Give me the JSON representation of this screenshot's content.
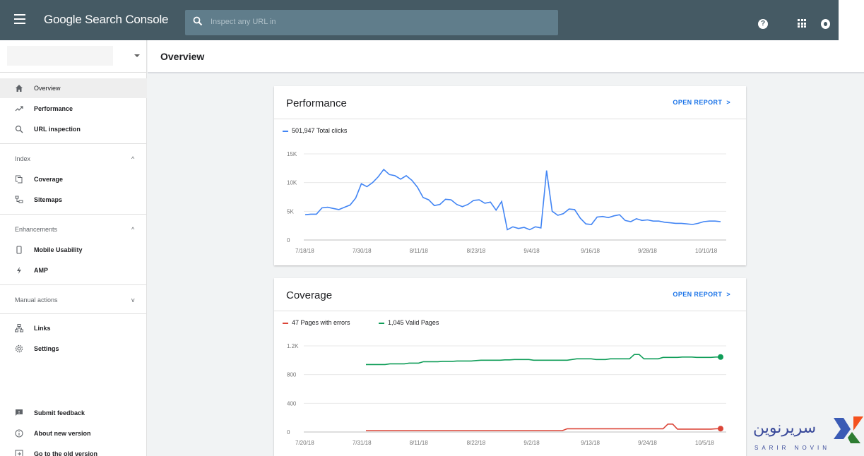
{
  "app": {
    "title": "Google Search Console",
    "search_placeholder": "Inspect any URL in",
    "icons": [
      "menu-icon",
      "search-icon",
      "help-icon",
      "apps-icon",
      "notifications-icon"
    ]
  },
  "sidebar": {
    "items_top": [
      {
        "label": "Overview",
        "icon": "home-icon"
      },
      {
        "label": "Performance",
        "icon": "trending-icon"
      },
      {
        "label": "URL inspection",
        "icon": "search-icon"
      }
    ],
    "index": {
      "label": "Index",
      "items": [
        {
          "label": "Coverage",
          "icon": "coverage-icon"
        },
        {
          "label": "Sitemaps",
          "icon": "sitemap-icon"
        }
      ]
    },
    "enhancements": {
      "label": "Enhancements",
      "items": [
        {
          "label": "Mobile Usability",
          "icon": "phone-icon"
        },
        {
          "label": "AMP",
          "icon": "bolt-icon"
        }
      ]
    },
    "manual_actions": {
      "label": "Manual actions"
    },
    "items_mid": [
      {
        "label": "Links",
        "icon": "links-icon"
      },
      {
        "label": "Settings",
        "icon": "gear-icon"
      }
    ],
    "items_bottom": [
      {
        "label": "Submit feedback",
        "icon": "feedback-icon"
      },
      {
        "label": "About new version",
        "icon": "info-icon"
      },
      {
        "label": "Go to the old version",
        "icon": "exit-icon"
      }
    ]
  },
  "main": {
    "title": "Overview"
  },
  "performance": {
    "title": "Performance",
    "open_report": "OPEN REPORT",
    "legend": "501,947 Total clicks",
    "color": "#4285f4"
  },
  "coverage": {
    "title": "Coverage",
    "open_report": "OPEN REPORT",
    "legend_errors": "47 Pages with errors",
    "legend_valid": "1,045 Valid Pages",
    "color_errors": "#db4437",
    "color_valid": "#0f9d58"
  },
  "watermark": {
    "text_fa": "سریرنوین",
    "text_en": "SARIR NOVIN"
  },
  "chart_data": [
    {
      "type": "line",
      "x": [
        "7/18/18",
        "7/30/18",
        "8/11/18",
        "8/23/18",
        "9/4/18",
        "9/16/18",
        "9/28/18",
        "10/10/18"
      ],
      "ytick_labels": [
        "0",
        "5K",
        "10K",
        "15K"
      ],
      "ylim": [
        0,
        15000
      ],
      "grid": true,
      "series": [
        {
          "name": "501,947 Total clicks",
          "values": [
            4400,
            4500,
            4500,
            5600,
            5700,
            5500,
            5300,
            5700,
            6100,
            7300,
            9800,
            9300,
            10000,
            11000,
            12300,
            11400,
            11200,
            10600,
            11200,
            10400,
            9200,
            7400,
            7000,
            6000,
            6200,
            7100,
            7000,
            6200,
            5800,
            6200,
            6900,
            7000,
            6400,
            6600,
            5200,
            6700,
            1800,
            2300,
            2000,
            2200,
            1800,
            2300,
            2100,
            12100,
            5000,
            4300,
            4600,
            5400,
            5300,
            3800,
            2800,
            2700,
            4000,
            4100,
            3900,
            4200,
            4400,
            3400,
            3200,
            3700,
            3400,
            3500,
            3300,
            3300,
            3100,
            3000,
            2900,
            2900,
            2800,
            2700,
            2900,
            3200,
            3300,
            3300,
            3200
          ]
        }
      ]
    },
    {
      "type": "line",
      "x": [
        "7/20/18",
        "7/31/18",
        "8/11/18",
        "8/22/18",
        "9/2/18",
        "9/13/18",
        "9/24/18",
        "10/5/18"
      ],
      "ytick_labels": [
        "0",
        "400",
        "800",
        "1.2K"
      ],
      "ylim": [
        0,
        1200
      ],
      "grid": true,
      "series": [
        {
          "name": "47 Pages with errors",
          "values": [
            20,
            20,
            20,
            20,
            20,
            20,
            20,
            20,
            20,
            20,
            20,
            20,
            20,
            20,
            20,
            20,
            20,
            20,
            20,
            20,
            20,
            20,
            20,
            20,
            20,
            20,
            20,
            20,
            20,
            20,
            20,
            20,
            20,
            20,
            20,
            20,
            20,
            20,
            20,
            20,
            20,
            20,
            45,
            45,
            45,
            45,
            45,
            45,
            45,
            45,
            45,
            45,
            45,
            45,
            45,
            45,
            45,
            45,
            45,
            45,
            45,
            45,
            45,
            110,
            110,
            40,
            40,
            40,
            40,
            40,
            40,
            40,
            40,
            45,
            47
          ]
        },
        {
          "name": "1,045 Valid Pages",
          "values": [
            940,
            940,
            940,
            940,
            940,
            950,
            950,
            950,
            950,
            960,
            960,
            960,
            980,
            980,
            980,
            980,
            985,
            985,
            985,
            990,
            990,
            990,
            990,
            995,
            1000,
            1000,
            1000,
            1000,
            1000,
            1005,
            1005,
            1010,
            1010,
            1010,
            1010,
            1000,
            1000,
            1000,
            1000,
            1000,
            1000,
            1000,
            1000,
            1010,
            1020,
            1020,
            1020,
            1020,
            1010,
            1010,
            1010,
            1020,
            1020,
            1020,
            1020,
            1020,
            1080,
            1080,
            1020,
            1020,
            1020,
            1020,
            1040,
            1040,
            1040,
            1040,
            1045,
            1045,
            1045,
            1040,
            1040,
            1040,
            1040,
            1045,
            1045
          ]
        }
      ]
    }
  ]
}
